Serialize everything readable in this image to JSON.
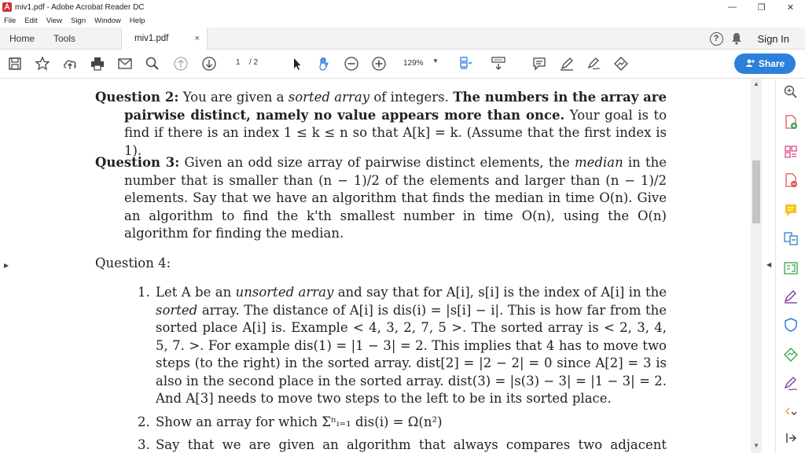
{
  "window": {
    "title": "miv1.pdf - Adobe Acrobat Reader DC",
    "minimize": "—",
    "maximize": "❐",
    "close": "✕"
  },
  "menu": [
    "File",
    "Edit",
    "View",
    "Sign",
    "Window",
    "Help"
  ],
  "tabs": {
    "home": "Home",
    "tools": "Tools",
    "document": "miv1.pdf",
    "close": "×",
    "help": "?",
    "sign_in": "Sign In"
  },
  "toolbar": {
    "page_current": "1",
    "page_total": "/ 2",
    "zoom": "129%",
    "zoom_caret": "▼",
    "share": "Share"
  },
  "document": {
    "q2": {
      "head": "Question 2:",
      "l1a": "You are given a ",
      "l1b": "sorted array",
      "l1c": " of integers. ",
      "l1d": "The numbers in the array are",
      "l2": "pairwise distinct, namely no value appears more than once.",
      "l2b": " Your goal is to",
      "l3": "find if there is an index 1 ≤ k ≤ n so that A[k] = k. (Assume that the first index is 1)."
    },
    "q3": {
      "head": "Question 3:",
      "l1a": "Given an odd size array of pairwise distinct elements, the ",
      "l1b": "median",
      "l1c": " in the",
      "l2": "number that is smaller than (n − 1)/2 of the elements and larger than (n − 1)/2",
      "l3": "elements. Say that we have an algorithm that finds the median in time O(n). Give an",
      "l4": "algorithm to find the k'th smallest number in time O(n), using the O(n) algorithm for",
      "l5": "finding the median."
    },
    "q4": {
      "head": "Question 4:",
      "i1_num": "1.",
      "i1_l1a": "Let A be an ",
      "i1_l1b": "unsorted array",
      "i1_l1c": " and say that for A[i], s[i] is the index of A[i] in the",
      "i1_l2a": "sorted",
      "i1_l2b": " array. The distance of A[i] is dis(i) = |s[i] − i|. This is how far from the",
      "i1_l3": "sorted place A[i] is. Example < 4, 3, 2, 7, 5 >. The sorted array is < 2, 3, 4, 5, 7. >.",
      "i1_l4": "For example dis(1) = |1 − 3| = 2. This implies that 4 has to move two steps (to",
      "i1_l5": "the right) in the sorted array. dist[2] = |2 − 2| = 0 since A[2] = 3 is also in the",
      "i1_l6": "second place in the sorted array. dist(3) = |s(3) − 3| = |1 − 3| = 2. And A[3]",
      "i1_l7": "needs to move two steps to the left to be in its sorted place.",
      "i2_num": "2.",
      "i2_l1": "Show an array for which Σⁿᵢ₌₁ dis(i) = Ω(n²)",
      "i3_num": "3.",
      "i3_l1": "Say that we are given an algorithm that always compares two adjacent numbers in"
    }
  },
  "colors": {
    "accent": "#2d7fd9",
    "acrobat_red": "#d32f2f",
    "comment_yellow": "#f5c518",
    "edit_purple": "#7b3fa0",
    "export_green": "#3aa54a"
  }
}
